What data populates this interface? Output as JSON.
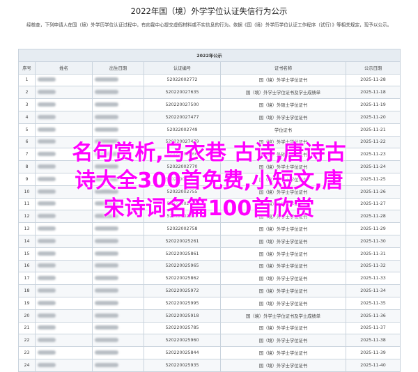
{
  "page": {
    "title": "2022年国（境）外学学位认证失信行为公示",
    "intro": "经核查，下列申请人在国（境）外学历学位认证过程中，有向我中心提交虚假材料或不实信息的行为。依据《国（境）外学历学位认证工作程序（试行）》等相关规定，现予以公示。"
  },
  "table": {
    "caption": "2022年公示",
    "headers": [
      "序号",
      "姓名",
      "出生日期",
      "认证编号",
      "证书名称",
      "公示日期"
    ],
    "rows": [
      {
        "seq": "1",
        "id": "52022002772",
        "cert": "国（境）外学士学位证书",
        "date": "2025-11-28"
      },
      {
        "seq": "2",
        "id": "520220027635",
        "cert": "国（境）外学士学位证书及学士成绩单",
        "date": "2025-11-18"
      },
      {
        "seq": "3",
        "id": "520220027500",
        "cert": "国（境）外硕士学位证书",
        "date": "2025-11-19"
      },
      {
        "seq": "4",
        "id": "520220027477",
        "cert": "国（境）外学士学位证书",
        "date": "2025-11-20"
      },
      {
        "seq": "5",
        "id": "52022002749",
        "cert": "学位证书",
        "date": "2025-11-21"
      },
      {
        "seq": "6",
        "id": "520220027479",
        "cert": "国（境）外学士学位证书",
        "date": "2025-11-22"
      },
      {
        "seq": "7",
        "id": "52022002766",
        "cert": "国（境）外硕士学位证书",
        "date": "2025-11-23"
      },
      {
        "seq": "8",
        "id": "52022002770",
        "cert": "国（境）外学士学位证书",
        "date": "2025-11-24"
      },
      {
        "seq": "9",
        "id": "520220027508",
        "cert": "国（境）外学士学位证书",
        "date": "2025-11-25"
      },
      {
        "seq": "10",
        "id": "52022002755",
        "cert": "国（境）外学士学位证书",
        "date": "2025-11-26"
      },
      {
        "seq": "11",
        "id": "52022002744",
        "cert": "国（境）外学士学位证书",
        "date": "2025-11-27"
      },
      {
        "seq": "12",
        "id": "52022002751",
        "cert": "国（境）外学士学位证书",
        "date": "2025-11-28"
      },
      {
        "seq": "13",
        "id": "52022002758",
        "cert": "国（境）外学士学位证书",
        "date": "2025-11-29"
      },
      {
        "seq": "14",
        "id": "520220025261",
        "cert": "国（境）外学士学位证书",
        "date": "2025-11-30"
      },
      {
        "seq": "15",
        "id": "520220025861",
        "cert": "国（境）外学士学位证书",
        "date": "2025-11-31"
      },
      {
        "seq": "16",
        "id": "520220025965",
        "cert": "国（境）外学士学位证书",
        "date": "2025-11-32"
      },
      {
        "seq": "17",
        "id": "520220025862",
        "cert": "国（境）外学士学位证书",
        "date": "2025-11-33"
      },
      {
        "seq": "18",
        "id": "520220025972",
        "cert": "国（境）外学士学位证书",
        "date": "2025-11-34"
      },
      {
        "seq": "19",
        "id": "520220025995",
        "cert": "国（境）外学士学位证书",
        "date": "2025-11-35"
      },
      {
        "seq": "20",
        "id": "520220025918",
        "cert": "国（境）外学士学位证书及学士成绩单",
        "date": "2025-11-36"
      },
      {
        "seq": "21",
        "id": "520220025785",
        "cert": "国（境）外学士学位证书",
        "date": "2025-11-37"
      },
      {
        "seq": "22",
        "id": "520220025960",
        "cert": "国（境）外学士学位证书",
        "date": "2025-11-38"
      },
      {
        "seq": "23",
        "id": "520220025844",
        "cert": "国（境）外学士学位证书",
        "date": "2025-11-39"
      },
      {
        "seq": "24",
        "id": "520220025935",
        "cert": "国（境）外学士学位证书",
        "date": "2025-11-40"
      }
    ]
  },
  "overlay": {
    "line1": "名句赏析,乌衣巷 古诗,唐诗古",
    "line2": "诗大全300首免费,小短文,唐",
    "line3": "宋诗词名篇100首欣赏",
    "color": "#ff00ff"
  }
}
